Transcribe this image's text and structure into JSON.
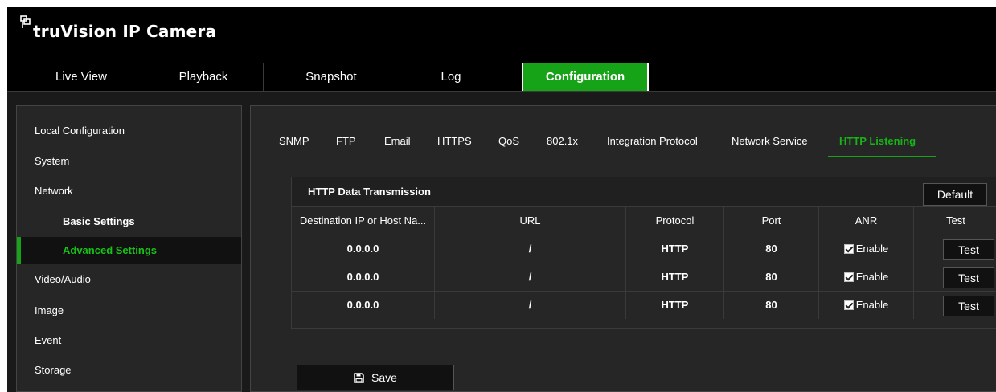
{
  "app": {
    "logo_text": "truVision  IP Camera"
  },
  "nav": {
    "items": [
      {
        "label": "Live View"
      },
      {
        "label": "Playback"
      },
      {
        "label": "Snapshot"
      },
      {
        "label": "Log"
      },
      {
        "label": "Configuration",
        "active": true
      }
    ]
  },
  "sidebar": {
    "items": [
      {
        "label": "Local Configuration"
      },
      {
        "label": "System"
      },
      {
        "label": "Network"
      },
      {
        "label": "Basic Settings"
      },
      {
        "label": "Advanced Settings",
        "active": true
      },
      {
        "label": "Video/Audio"
      },
      {
        "label": "Image"
      },
      {
        "label": "Event"
      },
      {
        "label": "Storage"
      }
    ]
  },
  "tabs": [
    {
      "label": "SNMP"
    },
    {
      "label": "FTP"
    },
    {
      "label": "Email"
    },
    {
      "label": "HTTPS"
    },
    {
      "label": "QoS"
    },
    {
      "label": "802.1x"
    },
    {
      "label": "Integration Protocol"
    },
    {
      "label": "Network Service"
    },
    {
      "label": "HTTP Listening",
      "active": true
    }
  ],
  "table": {
    "title": "HTTP Data Transmission",
    "default_label": "Default",
    "columns": [
      "Destination IP or Host Na...",
      "URL",
      "Protocol",
      "Port",
      "ANR",
      "Test"
    ],
    "rows": [
      {
        "ip": "0.0.0.0",
        "url": "/",
        "protocol": "HTTP",
        "port": "80",
        "anr_checked": true,
        "anr_label": "Enable",
        "test_label": "Test"
      },
      {
        "ip": "0.0.0.0",
        "url": "/",
        "protocol": "HTTP",
        "port": "80",
        "anr_checked": true,
        "anr_label": "Enable",
        "test_label": "Test"
      },
      {
        "ip": "0.0.0.0",
        "url": "/",
        "protocol": "HTTP",
        "port": "80",
        "anr_checked": true,
        "anr_label": "Enable",
        "test_label": "Test"
      }
    ]
  },
  "save_label": "Save",
  "colors": {
    "accent": "#17a317",
    "background": "#1a1a1a",
    "panel": "#262626"
  }
}
